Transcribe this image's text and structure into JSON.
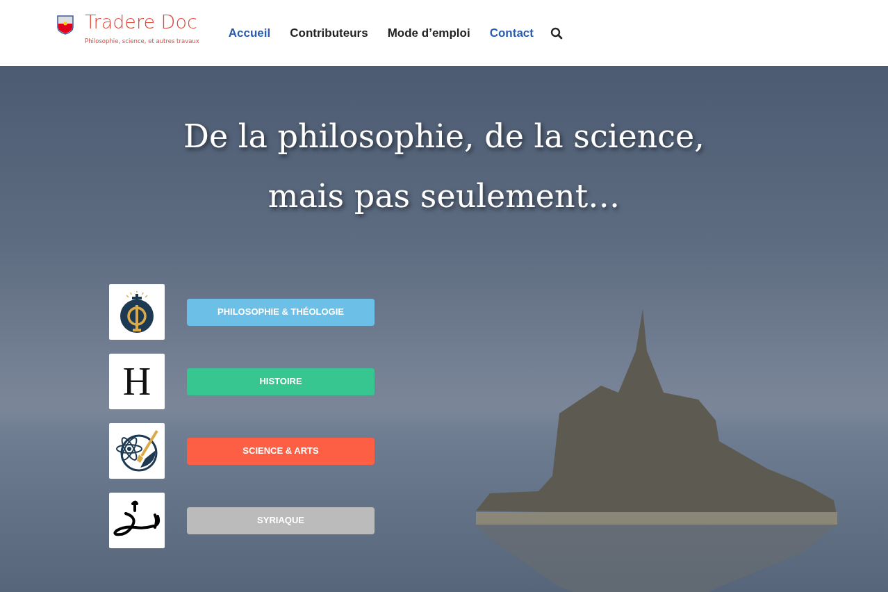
{
  "brand": {
    "name": "Tradere Doc",
    "tagline": "Philosophie, science, et autres travaux"
  },
  "nav": [
    {
      "label": "Accueil",
      "color": "#2a5cb0"
    },
    {
      "label": "Contributeurs",
      "color": "#222222"
    },
    {
      "label": "Mode d’emploi",
      "color": "#222222"
    },
    {
      "label": "Contact",
      "color": "#2a5cb0"
    }
  ],
  "hero": {
    "title_lines": [
      "De la philosophie, de la science,",
      "mais pas seulement…"
    ]
  },
  "categories": [
    {
      "kind": "phi",
      "label": "PHILOSOPHIE & THÉOLOGIE",
      "color": "#6cbfe6"
    },
    {
      "kind": "letter",
      "glyph": "H",
      "label": "HISTOIRE",
      "color": "#37c68f"
    },
    {
      "kind": "science",
      "label": "SCIENCE & ARTS",
      "color": "#fd5f45"
    },
    {
      "kind": "syriac",
      "label": "SYRIAQUE",
      "color": "#bbbbbb"
    }
  ]
}
